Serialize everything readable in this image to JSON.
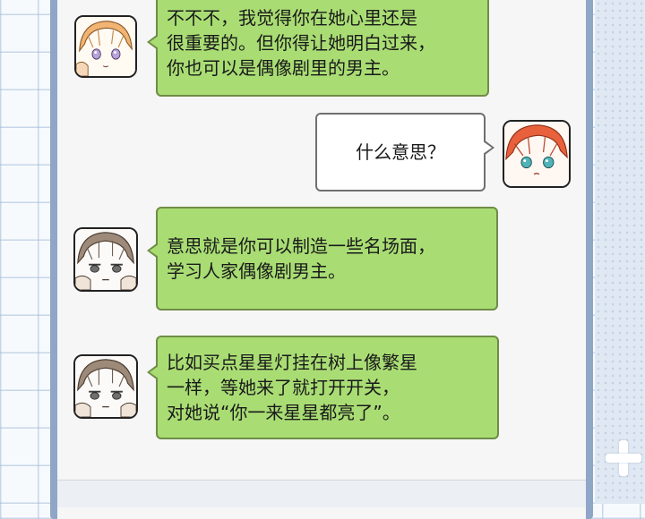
{
  "chat": {
    "messages": [
      {
        "sender": "blonde-friend",
        "side": "left",
        "lines": [
          "不不不，我觉得你在她心里还是",
          "很重要的。但你得让她明白过来，",
          "你也可以是偶像剧里的男主。"
        ]
      },
      {
        "sender": "red-hair-boy",
        "side": "right",
        "lines": [
          "什么意思？"
        ]
      },
      {
        "sender": "brown-hair-friend",
        "side": "left",
        "lines": [
          "意思就是你可以制造一些名场面，",
          "学习人家偶像剧男主。"
        ]
      },
      {
        "sender": "brown-hair-friend",
        "side": "left",
        "lines": [
          "比如买点星星灯挂在树上像繁星",
          "一样，等她来了就打开开关，",
          "对她说“你一来星星都亮了”。"
        ]
      }
    ]
  },
  "colors": {
    "bubble_green": "#a9dd74",
    "bubble_white": "#ffffff",
    "phone_frame": "#8fa6c6",
    "screen_bg": "#f6f6f6"
  }
}
